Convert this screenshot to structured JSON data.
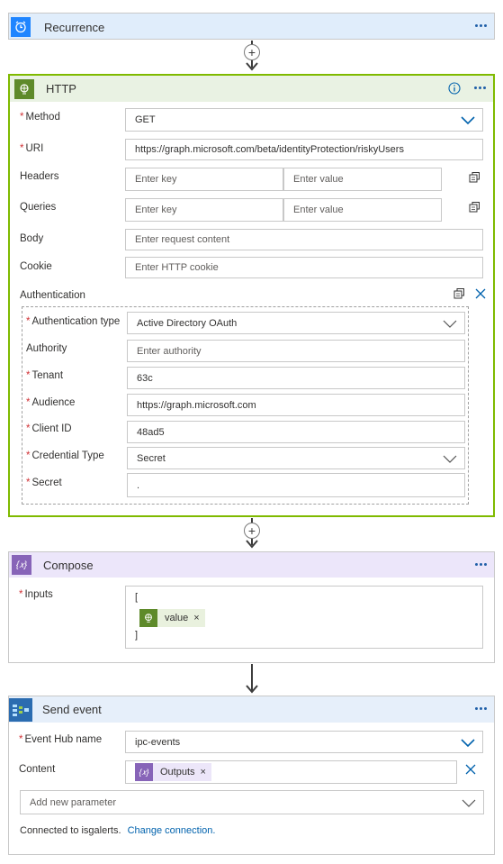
{
  "recurrence": {
    "title": "Recurrence"
  },
  "http": {
    "title": "HTTP",
    "method": {
      "label": "Method",
      "value": "GET"
    },
    "uri": {
      "label": "URI",
      "value": "https://graph.microsoft.com/beta/identityProtection/riskyUsers"
    },
    "headers": {
      "label": "Headers",
      "key_placeholder": "Enter key",
      "value_placeholder": "Enter value"
    },
    "queries": {
      "label": "Queries",
      "key_placeholder": "Enter key",
      "value_placeholder": "Enter value"
    },
    "body": {
      "label": "Body",
      "placeholder": "Enter request content"
    },
    "cookie": {
      "label": "Cookie",
      "placeholder": "Enter HTTP cookie"
    },
    "authentication": {
      "label": "Authentication",
      "type": {
        "label": "Authentication type",
        "value": "Active Directory OAuth"
      },
      "authority": {
        "label": "Authority",
        "placeholder": "Enter authority"
      },
      "tenant": {
        "label": "Tenant",
        "value": "63c"
      },
      "audience": {
        "label": "Audience",
        "value": "https://graph.microsoft.com"
      },
      "client_id": {
        "label": "Client ID",
        "value": "48ad5"
      },
      "credential_type": {
        "label": "Credential Type",
        "value": "Secret"
      },
      "secret": {
        "label": "Secret",
        "value": "."
      }
    }
  },
  "compose": {
    "title": "Compose",
    "inputs": {
      "label": "Inputs",
      "open": "[",
      "token": "value",
      "close": "]"
    }
  },
  "send_event": {
    "title": "Send event",
    "event_hub": {
      "label": "Event Hub name",
      "value": "ipc-events"
    },
    "content": {
      "label": "Content",
      "token": "Outputs"
    },
    "add_param": {
      "placeholder": "Add new parameter"
    },
    "connection": {
      "text": "Connected to isgalerts.",
      "link": "Change connection."
    }
  },
  "colors": {
    "recurrence_bg": "#e0edfb",
    "recurrence_icon": "#1f85ff",
    "http_bg": "#e9f2e3",
    "http_icon": "#5e8a2a",
    "http_border": "#7fba00",
    "compose_bg": "#ece6fa",
    "compose_icon": "#8764b8",
    "send_bg": "#e6effa",
    "link": "#0062ad",
    "required": "#d13438"
  }
}
